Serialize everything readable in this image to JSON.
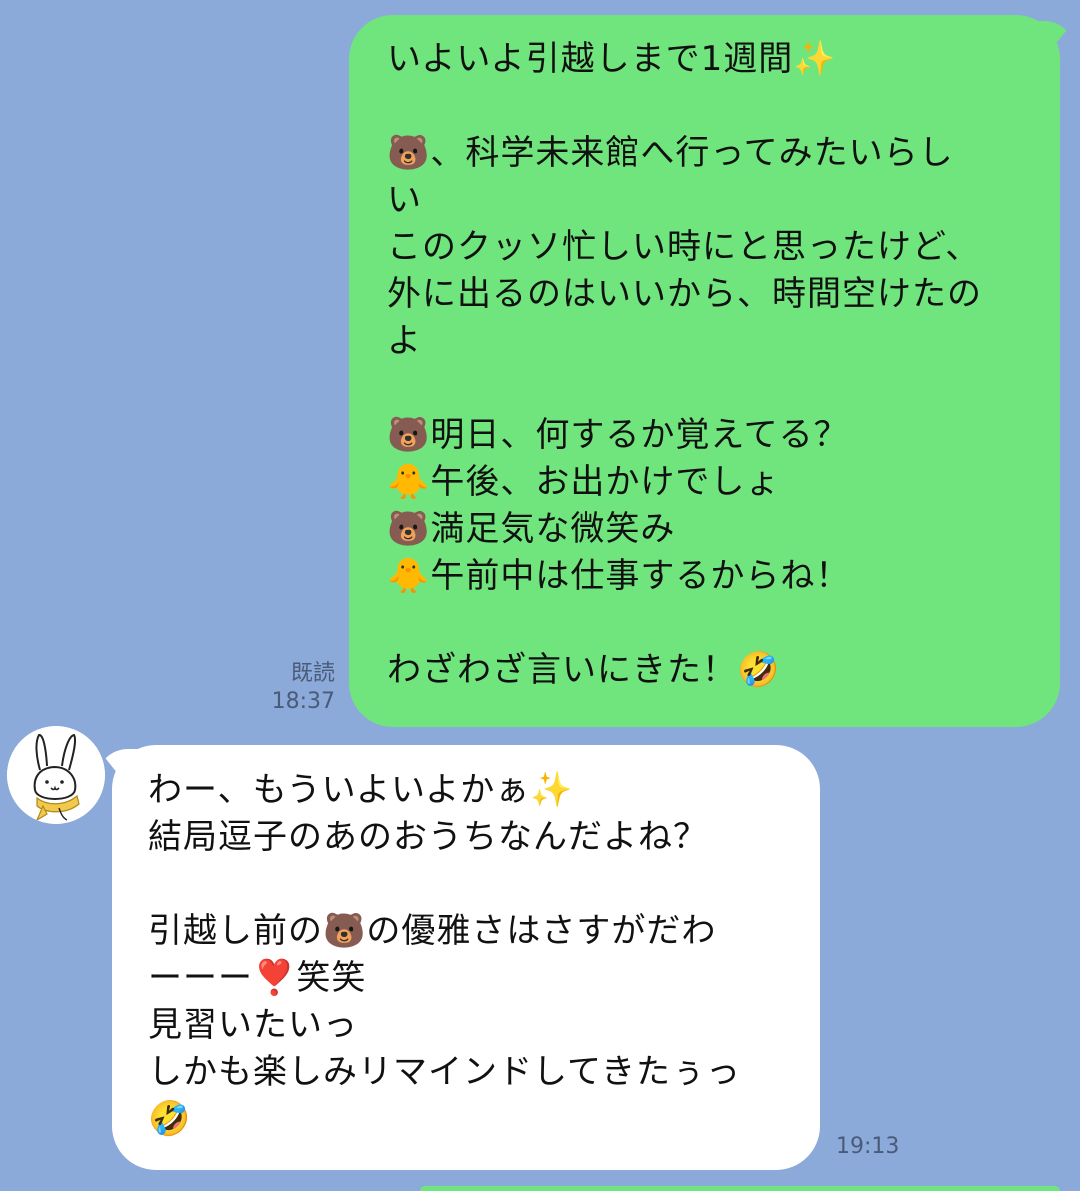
{
  "sent_message": {
    "lines": [
      "いよいよ引越しまで1週間✨",
      "",
      "🐻、科学未来館へ行ってみたいらし",
      "い",
      "このクッソ忙しい時にと思ったけど、",
      "外に出るのはいいから、時間空けたの",
      "よ",
      "",
      "🐻明日、何するか覚えてる？",
      "🐥午後、お出かけでしょ",
      "🐻満足気な微笑み",
      "🐥午前中は仕事するからね！",
      "",
      "わざわざ言いにきた！🤣"
    ],
    "read_label": "既読",
    "time": "18:37"
  },
  "received_message": {
    "lines": [
      "わー、もういよいよかぁ✨",
      "結局逗子のあのおうちなんだよね？",
      "",
      "引越し前の🐻の優雅さはさすがだわ",
      "ーーー❣️笑笑",
      "見習いたいっ",
      "しかも楽しみリマインドしてきたぅっ",
      "🤣"
    ],
    "time": "19:13"
  },
  "avatar": {
    "icon": "rabbit-avatar-icon"
  },
  "colors": {
    "background": "#8ba9d9",
    "sent_bubble": "#71e57d",
    "received_bubble": "#ffffff"
  }
}
